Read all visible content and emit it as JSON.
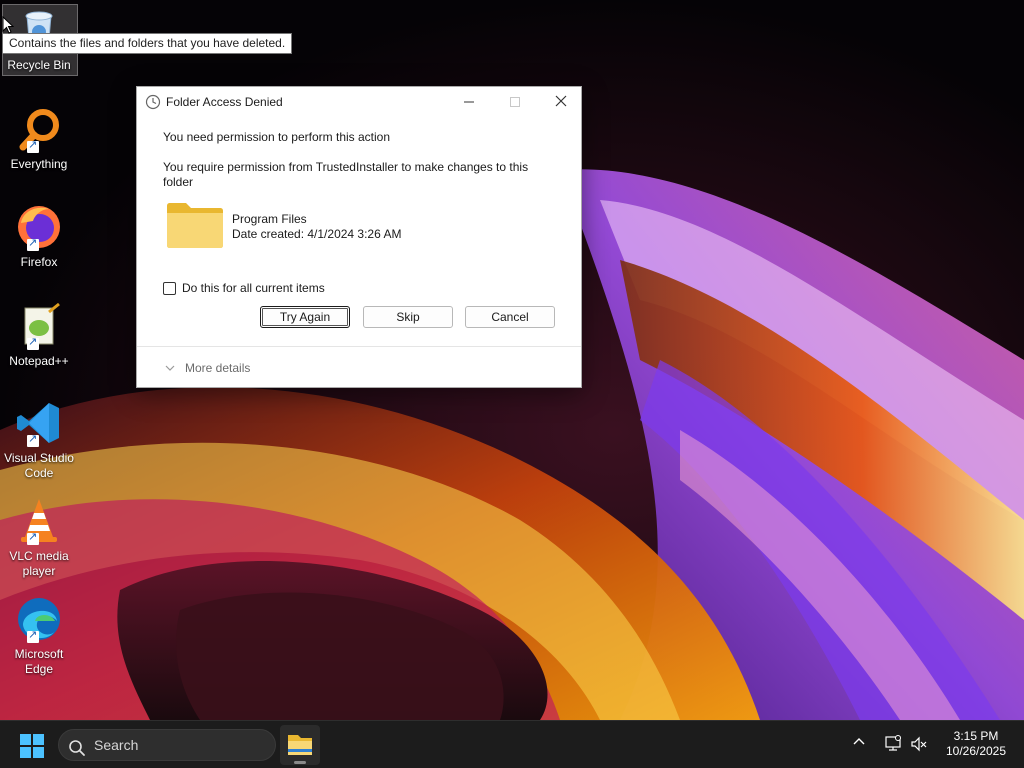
{
  "desktop": {
    "icons": [
      {
        "label": "Recycle Bin",
        "icon": "recycle-bin-icon"
      },
      {
        "label": "Everything",
        "icon": "everything-search-icon"
      },
      {
        "label": "Firefox",
        "icon": "firefox-icon"
      },
      {
        "label": "Notepad++",
        "icon": "notepad-plus-plus-icon"
      },
      {
        "label": "Visual Studio Code",
        "icon": "vscode-icon"
      },
      {
        "label": "VLC media player",
        "icon": "vlc-icon"
      },
      {
        "label": "Microsoft Edge",
        "icon": "edge-icon"
      }
    ],
    "tooltip": "Contains the files and folders that you have deleted."
  },
  "dialog": {
    "title": "Folder Access Denied",
    "message": "You need permission to perform this action",
    "detail": "You require permission from TrustedInstaller to make changes to this folder",
    "folder": {
      "name": "Program Files",
      "date_created": "Date created: 4/1/2024 3:26 AM"
    },
    "checkbox_label": "Do this for all current items",
    "checkbox_checked": false,
    "buttons": {
      "try_again": "Try Again",
      "skip": "Skip",
      "cancel": "Cancel"
    },
    "more_details": "More details"
  },
  "taskbar": {
    "search_label": "Search",
    "clock_time": "3:15 PM",
    "clock_date": "10/26/2025"
  },
  "colors": {
    "taskbar_bg": "#1c1c1c",
    "accent": "#0078d4",
    "folder_yellow": "#f5cf4d"
  }
}
